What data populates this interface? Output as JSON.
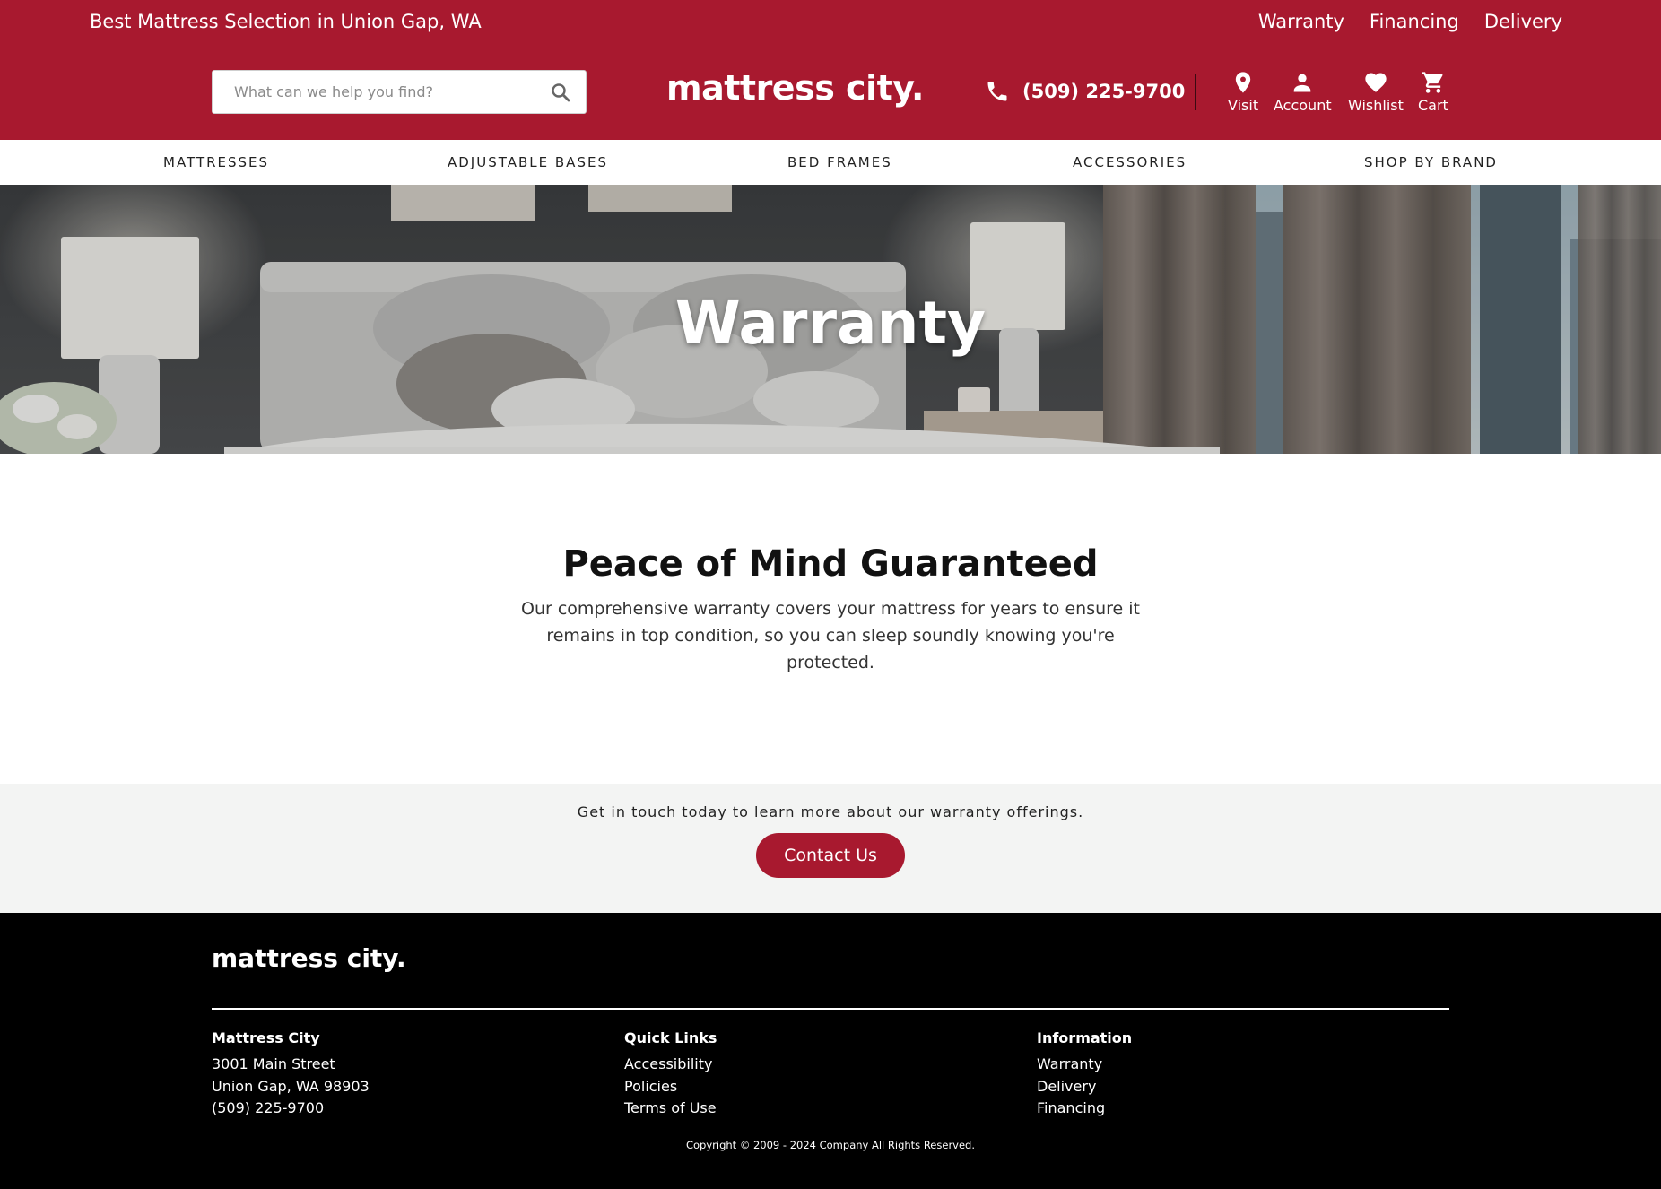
{
  "topbar": {
    "tagline": "Best Mattress Selection in Union Gap, WA",
    "links": [
      "Warranty",
      "Financing",
      "Delivery"
    ]
  },
  "header": {
    "search_placeholder": "What can we help you find?",
    "logo": "mattress city.",
    "phone": "(509) 225-9700",
    "utility": [
      {
        "label": "Visit",
        "icon": "map-pin-icon"
      },
      {
        "label": "Account",
        "icon": "person-icon"
      },
      {
        "label": "Wishlist",
        "icon": "heart-icon"
      },
      {
        "label": "Cart",
        "icon": "cart-icon"
      }
    ],
    "brand_color": "#a8192f"
  },
  "nav": {
    "items": [
      "MATTRESSES",
      "ADJUSTABLE BASES",
      "BED FRAMES",
      "ACCESSORIES",
      "SHOP BY BRAND"
    ]
  },
  "hero": {
    "title": "Warranty"
  },
  "intro": {
    "heading": "Peace of Mind Guaranteed",
    "text": "Our comprehensive warranty covers your mattress for years to ensure it remains in top condition, so you can sleep soundly knowing you're protected."
  },
  "cta": {
    "text": "Get in touch today to learn more about our warranty offerings.",
    "button": "Contact Us"
  },
  "footer": {
    "logo": "mattress city.",
    "columns": [
      {
        "title": "Mattress City",
        "lines": [
          "3001 Main Street",
          "Union Gap, WA 98903",
          "(509) 225-9700"
        ]
      },
      {
        "title": "Quick Links",
        "lines": [
          "Accessibility",
          "Policies",
          "Terms of Use"
        ]
      },
      {
        "title": "Information",
        "lines": [
          "Warranty",
          "Delivery",
          "Financing"
        ]
      }
    ],
    "copyright": "Copyright © 2009 - 2024 Company All Rights Reserved."
  }
}
